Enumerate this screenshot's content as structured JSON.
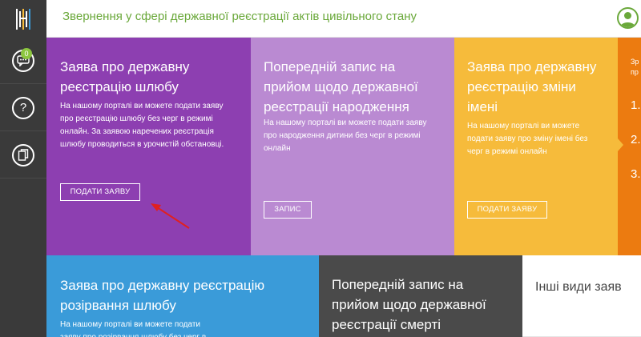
{
  "header": {
    "title": "Звернення у сфері державної реєстрації актів цивільного стану"
  },
  "sidebar": {
    "items": [
      {
        "icon": "chat-icon",
        "badge": "0"
      },
      {
        "icon": "help-icon",
        "symbol": "?"
      },
      {
        "icon": "documents-icon"
      }
    ]
  },
  "tiles": {
    "marriage": {
      "title": "Заява про державну реєстрацію шлюбу",
      "text": "На нашому порталі ви можете подати заяву про реєстрацію шлюбу без черг в режимі онлайн. За заявою наречених реєстрація шлюбу проводиться в урочистій обстановці.",
      "button": "ПОДАТИ ЗАЯВУ"
    },
    "birth": {
      "title": "Попередній запис на прийом щодо державної реєстрації народження",
      "text": "На нашому порталі ви можете подати заяву про народження дитини без черг в режимі онлайн",
      "button": "ЗАПИС"
    },
    "name_change": {
      "title": "Заява про державну реєстрацію зміни імені",
      "text": "На нашому порталі ви можете подати заяву про зміну імені без черг в режимі онлайн",
      "button": "ПОДАТИ ЗАЯВУ"
    },
    "orange": {
      "line1": "Зр",
      "line2": "пр",
      "items": [
        "1.",
        "2.",
        "3."
      ]
    },
    "divorce": {
      "title": "Заява про державну реєстрацію розірвання шлюбу",
      "text": "На нашому порталі ви можете подати заяву про розірвання шлюбу без черг в"
    },
    "death": {
      "title": "Попередній запис на прийом щодо державної реєстрації смерті"
    },
    "other": {
      "title": "Інші види заяв"
    }
  },
  "colors": {
    "header_title": "#6aa83a",
    "sidebar": "#3a3a3a",
    "purple": "#8d3fb1",
    "lilac": "#ba8ad2",
    "yellow": "#f6bb3b",
    "orange": "#ec7b10",
    "blue": "#3a9bd9",
    "gray": "#4a4a4a",
    "annotation_arrow": "#e02020"
  }
}
